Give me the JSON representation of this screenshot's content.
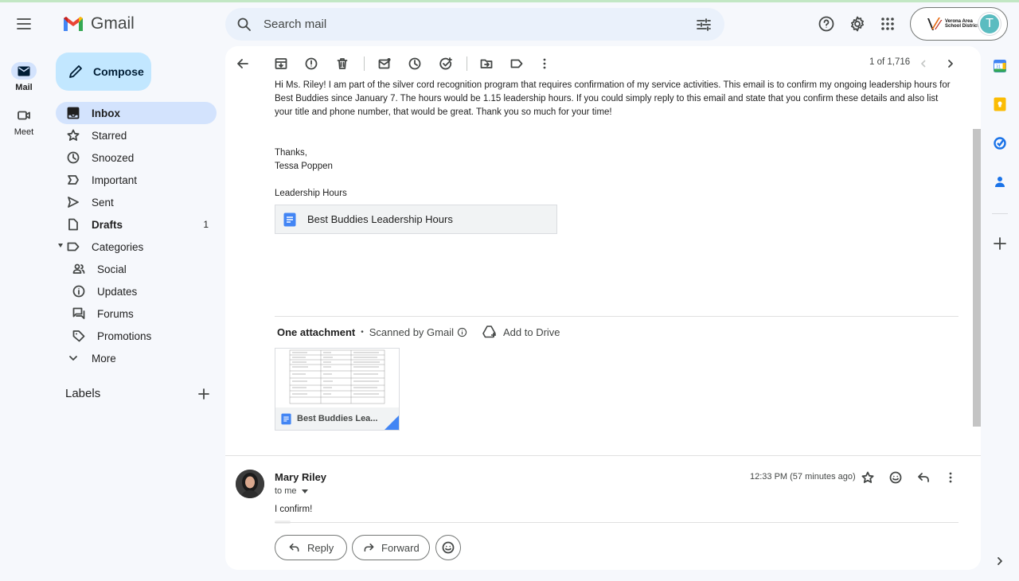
{
  "app": {
    "name": "Gmail"
  },
  "search": {
    "placeholder": "Search mail"
  },
  "account": {
    "org_name": "Verona Area School District",
    "avatar_initial": "T"
  },
  "rail": {
    "mail_label": "Mail",
    "meet_label": "Meet"
  },
  "sidebar": {
    "compose_label": "Compose",
    "items": [
      {
        "label": "Inbox",
        "icon": "inbox-icon",
        "count": ""
      },
      {
        "label": "Starred",
        "icon": "star-icon",
        "count": ""
      },
      {
        "label": "Snoozed",
        "icon": "clock-icon",
        "count": ""
      },
      {
        "label": "Important",
        "icon": "important-icon",
        "count": ""
      },
      {
        "label": "Sent",
        "icon": "send-icon",
        "count": ""
      },
      {
        "label": "Drafts",
        "icon": "draft-icon",
        "count": "1"
      },
      {
        "label": "Categories",
        "icon": "label-icon",
        "count": ""
      },
      {
        "label": "Social",
        "icon": "people-icon",
        "count": ""
      },
      {
        "label": "Updates",
        "icon": "info-icon",
        "count": ""
      },
      {
        "label": "Forums",
        "icon": "forum-icon",
        "count": ""
      },
      {
        "label": "Promotions",
        "icon": "tag-icon",
        "count": ""
      },
      {
        "label": "More",
        "icon": "chevron-down-icon",
        "count": ""
      }
    ],
    "labels_heading": "Labels"
  },
  "toolbar": {
    "pager": "1 of 1,716"
  },
  "message1": {
    "body": "Hi Ms. Riley! I am part of the silver cord recognition program that requires confirmation of my service activities. This email is to confirm my ongoing leadership hours for Best Buddies since January 7. The hours would be 1.15 leadership hours. If you could simply reply to this email and state that you confirm these details and also list your title and phone number, that would be great. Thank you so much for your time!",
    "signoff": "Thanks,",
    "signature": "Tessa Poppen",
    "doc_heading": "Leadership Hours",
    "doc_chip": "Best Buddies Leadership Hours"
  },
  "attachments": {
    "title": "One attachment",
    "scanned": "Scanned by Gmail",
    "add_to_drive": "Add to Drive",
    "file_name": "Best Buddies Lea..."
  },
  "message2": {
    "sender": "Mary Riley",
    "to": "to me",
    "time": "12:33 PM (57 minutes ago)",
    "body": "I confirm!"
  },
  "actions": {
    "reply": "Reply",
    "forward": "Forward"
  }
}
